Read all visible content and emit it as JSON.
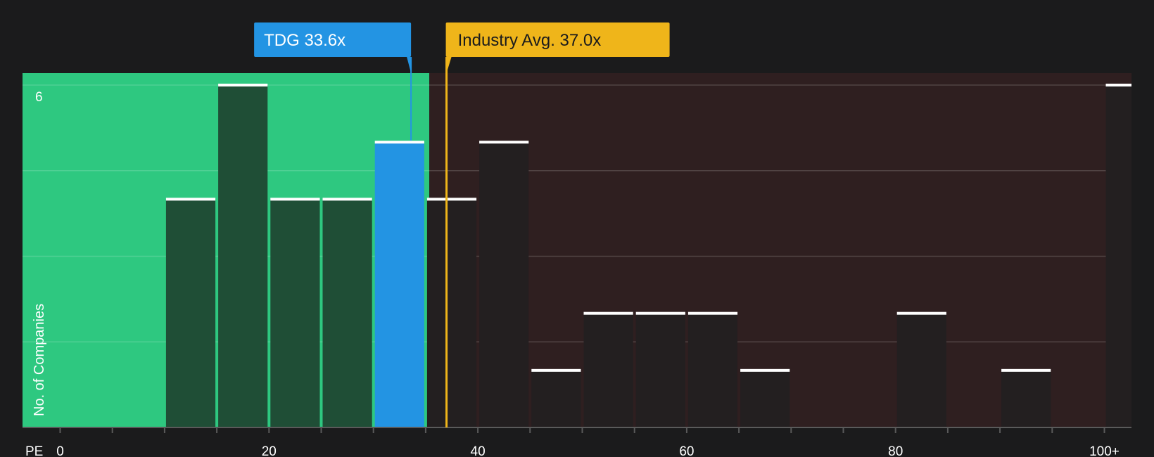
{
  "chart_data": {
    "type": "bar",
    "xlabel": "PE",
    "ylabel": "No. of Companies",
    "x_ticks": [
      "0",
      "20",
      "40",
      "60",
      "80",
      "100+"
    ],
    "y_ticks": [
      "6"
    ],
    "ylim": [
      0,
      6
    ],
    "xlim": [
      -5,
      100
    ],
    "bin_width": 5,
    "bins": [
      {
        "x0": 10,
        "value": 4
      },
      {
        "x0": 15,
        "value": 6
      },
      {
        "x0": 20,
        "value": 4
      },
      {
        "x0": 25,
        "value": 4
      },
      {
        "x0": 30,
        "value": 5,
        "highlight": true
      },
      {
        "x0": 35,
        "value": 4
      },
      {
        "x0": 40,
        "value": 5
      },
      {
        "x0": 45,
        "value": 1
      },
      {
        "x0": 50,
        "value": 2
      },
      {
        "x0": 55,
        "value": 2
      },
      {
        "x0": 60,
        "value": 2
      },
      {
        "x0": 65,
        "value": 1
      },
      {
        "x0": 80,
        "value": 2
      },
      {
        "x0": 90,
        "value": 1
      },
      {
        "x0": 100,
        "value": 6
      }
    ],
    "company": {
      "label": "TDG 33.6x",
      "value": 33.6
    },
    "industry_avg": {
      "label": "Industry Avg. 37.0x",
      "value": 37.0
    },
    "colors": {
      "background": "#1b1b1c",
      "below_region": "#2ec880",
      "above_region": "#2f1f20",
      "bar_below": "#1f4e36",
      "bar_above": "#231f20",
      "highlight_bar": "#2394e3",
      "company_callout": "#2394e3",
      "industry_callout": "#efb51a",
      "bar_cap": "#ffffff"
    }
  }
}
